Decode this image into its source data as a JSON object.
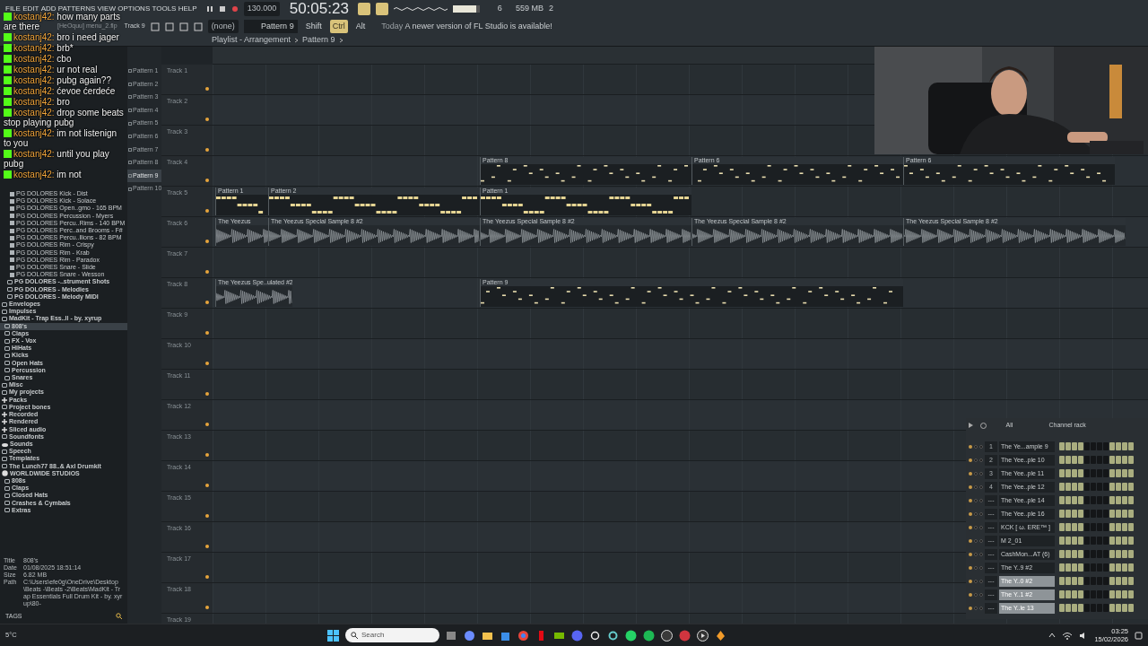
{
  "menu": [
    "FILE",
    "EDIT",
    "ADD",
    "PATTERNS",
    "VIEW",
    "OPTIONS",
    "TOOLS",
    "HELP"
  ],
  "project_file": "[HeOquu] menu_2.flp",
  "transport": {
    "tempo": "130.000",
    "time": "50:05:23"
  },
  "master_volume": {
    "level": 0.85
  },
  "toolbar": {
    "track_hint": "Track 9",
    "snap": "(none)",
    "pattern": "Pattern 9",
    "modifiers": [
      {
        "label": "Shift",
        "on": false
      },
      {
        "label": "Ctrl",
        "on": true
      },
      {
        "label": "Alt",
        "on": false
      }
    ],
    "news_date": "Today",
    "news": "A newer version of FL Studio is available!",
    "cpu": "6",
    "memory": "559 MB",
    "voices": "2"
  },
  "breadcrumb": [
    "Playlist - Arrangement",
    "Pattern 9"
  ],
  "chat": [
    {
      "user": "kostanj42:",
      "text": "how many parts are there"
    },
    {
      "user": "kostanj42:",
      "text": "bro i need jager"
    },
    {
      "user": "kostanj42:",
      "text": "brb*"
    },
    {
      "user": "kostanj42:",
      "text": "cbo"
    },
    {
      "user": "kostanj42:",
      "text": "ur not real"
    },
    {
      "user": "kostanj42:",
      "text": "pubg again??"
    },
    {
      "user": "kostanj42:",
      "text": "ćevoe ćerdeće"
    },
    {
      "user": "kostanj42:",
      "text": "bro"
    },
    {
      "user": "kostanj42:",
      "text": "drop some beats stop playing pubg"
    },
    {
      "user": "kostanj42:",
      "text": "im not listenign to you"
    },
    {
      "user": "kostanj42:",
      "text": "until you play pubg"
    },
    {
      "user": "kostanj42:",
      "text": "im not"
    }
  ],
  "patterns": [
    {
      "label": "Pattern 1",
      "selected": false
    },
    {
      "label": "Pattern 2",
      "selected": false
    },
    {
      "label": "Pattern 3",
      "selected": false
    },
    {
      "label": "Pattern 4",
      "selected": false
    },
    {
      "label": "Pattern 5",
      "selected": false
    },
    {
      "label": "Pattern 6",
      "selected": false
    },
    {
      "label": "Pattern 7",
      "selected": false
    },
    {
      "label": "Pattern 8",
      "selected": false
    },
    {
      "label": "Pattern 9",
      "selected": true
    },
    {
      "label": "Pattern 10",
      "selected": false
    }
  ],
  "browser": {
    "upper_files": [
      "PG DOLORES Kick - Dist",
      "PG DOLORES Kick - Solace",
      "PG DOLORES Open..gmo - 165 BPM",
      "PG DOLORES Percussion - Myers",
      "PG DOLORES Percu..Rims - 140 BPM",
      "PG DOLORES Perc..and Brooms - F#",
      "PG DOLORES Percu..llions - 82 BPM",
      "PG DOLORES Rim - Crispy",
      "PG DOLORES Rim - Krab",
      "PG DOLORES Rim - Paradox",
      "PG DOLORES Snare - Slide",
      "PG DOLORES Snare - Wesson"
    ],
    "upper_folders": [
      "PG DOLORES -..strument Shots",
      "PG DOLORES - Melodies",
      "PG DOLORES - Melody MIDI"
    ],
    "tree": [
      {
        "label": "Envelopes",
        "kind": "folder"
      },
      {
        "label": "Impulses",
        "kind": "folder"
      },
      {
        "label": "MadKit - Trap Ess..ll - by. xyrup",
        "kind": "folder",
        "children": [
          {
            "label": "808's",
            "kind": "folder",
            "selected": true
          },
          {
            "label": "Claps",
            "kind": "folder",
            "selected": false
          },
          {
            "label": "FX - Vox",
            "kind": "folder",
            "selected": false
          },
          {
            "label": "HiHats",
            "kind": "folder",
            "selected": false
          },
          {
            "label": "Kicks",
            "kind": "folder",
            "selected": false
          },
          {
            "label": "Open Hats",
            "kind": "folder",
            "selected": false
          },
          {
            "label": "Percussion",
            "kind": "folder",
            "selected": false
          },
          {
            "label": "Snares",
            "kind": "folder",
            "selected": false
          }
        ]
      },
      {
        "label": "Misc",
        "kind": "folder"
      },
      {
        "label": "My projects",
        "kind": "folder"
      },
      {
        "label": "Packs",
        "kind": "special"
      },
      {
        "label": "Project bones",
        "kind": "folder"
      },
      {
        "label": "Recorded",
        "kind": "special"
      },
      {
        "label": "Rendered",
        "kind": "special"
      },
      {
        "label": "Sliced audio",
        "kind": "special"
      },
      {
        "label": "Soundfonts",
        "kind": "folder"
      },
      {
        "label": "Sounds",
        "kind": "cloud"
      },
      {
        "label": "Speech",
        "kind": "folder"
      },
      {
        "label": "Templates",
        "kind": "folder"
      },
      {
        "label": "The Lunch77 88..& Axl Drumkit",
        "kind": "folder"
      },
      {
        "label": "WORLDWIDE STUDIOS",
        "kind": "globe",
        "children": [
          {
            "label": "808s",
            "kind": "folder"
          },
          {
            "label": "Claps",
            "kind": "folder"
          },
          {
            "label": "Closed Hats",
            "kind": "folder"
          },
          {
            "label": "Crashes & Cymbals",
            "kind": "folder"
          },
          {
            "label": "Extras",
            "kind": "folder"
          }
        ]
      }
    ],
    "info": [
      {
        "key": "Title",
        "value": "808's"
      },
      {
        "key": "Date",
        "value": "01/08/2025 18:51:14"
      },
      {
        "key": "Size",
        "value": "6.82 MB"
      },
      {
        "key": "Path",
        "value": "C:\\Users\\efe0g\\OneDrive\\Desktop\\Beats -\\Beats -2\\Beats\\MadKit - Trap Essentials Full Drum Kit - by. xyrup\\80-"
      }
    ],
    "tags_label": "TAGS"
  },
  "tracks": [
    {
      "label": "Track 1"
    },
    {
      "label": "Track 2"
    },
    {
      "label": "Track 3"
    },
    {
      "label": "Track 4",
      "clips": [
        {
          "kind": "pattern",
          "label": "Pattern 8"
        },
        {
          "kind": "pattern",
          "label": "Pattern 6"
        },
        {
          "kind": "pattern",
          "label": "Pattern 6"
        }
      ]
    },
    {
      "label": "Track 5",
      "clips": [
        {
          "kind": "chords",
          "label": "Pattern 1"
        },
        {
          "kind": "chords",
          "label": "Pattern 2"
        },
        {
          "kind": "chords",
          "label": "Pattern 1"
        }
      ]
    },
    {
      "label": "Track 6",
      "clips": [
        {
          "kind": "audio",
          "label": "The Yeezus"
        },
        {
          "kind": "audio",
          "label": "The Yeezus Special Sample 8 #2"
        },
        {
          "kind": "audio",
          "label": "The Yeezus Special Sample 8 #2"
        },
        {
          "kind": "audio",
          "label": "The Yeezus Special Sample 8 #2"
        },
        {
          "kind": "audio",
          "label": "The Yeezus Special Sample 8 #2"
        }
      ]
    },
    {
      "label": "Track 7"
    },
    {
      "label": "Track 8",
      "clips": [
        {
          "kind": "audio",
          "label": "The Yeezus Spe..ulated #2"
        },
        {
          "kind": "pattern",
          "label": "Pattern 9"
        }
      ]
    },
    {
      "label": "Track 9"
    },
    {
      "label": "Track 10"
    },
    {
      "label": "Track 11"
    },
    {
      "label": "Track 12"
    },
    {
      "label": "Track 13"
    },
    {
      "label": "Track 14"
    },
    {
      "label": "Track 15"
    },
    {
      "label": "Track 16"
    },
    {
      "label": "Track 17"
    },
    {
      "label": "Track 18"
    },
    {
      "label": "Track 19"
    }
  ],
  "channel_rack": {
    "filter": "All",
    "title": "Channel rack",
    "channels": [
      {
        "number": "1",
        "name": "The Ye...ample 9",
        "selected": false,
        "steps": [
          {
            "on": true
          },
          {
            "on": true
          },
          {
            "on": true
          },
          {
            "on": true
          },
          {
            "on": false
          },
          {
            "on": false
          },
          {
            "on": false
          },
          {
            "on": false
          },
          {
            "on": true
          },
          {
            "on": true
          },
          {
            "on": true
          },
          {
            "on": true
          }
        ]
      },
      {
        "number": "2",
        "name": "The Yee..ple 10",
        "selected": false,
        "steps": [
          {
            "on": true
          },
          {
            "on": true
          },
          {
            "on": true
          },
          {
            "on": true
          },
          {
            "on": false
          },
          {
            "on": false
          },
          {
            "on": false
          },
          {
            "on": false
          },
          {
            "on": true
          },
          {
            "on": true
          },
          {
            "on": true
          },
          {
            "on": true
          }
        ]
      },
      {
        "number": "3",
        "name": "The Yee..ple 11",
        "selected": false,
        "steps": [
          {
            "on": true
          },
          {
            "on": true
          },
          {
            "on": true
          },
          {
            "on": true
          },
          {
            "on": false
          },
          {
            "on": false
          },
          {
            "on": false
          },
          {
            "on": false
          },
          {
            "on": true
          },
          {
            "on": true
          },
          {
            "on": true
          },
          {
            "on": true
          }
        ]
      },
      {
        "number": "4",
        "name": "The Yee..ple 12",
        "selected": false,
        "steps": [
          {
            "on": true
          },
          {
            "on": true
          },
          {
            "on": true
          },
          {
            "on": true
          },
          {
            "on": false
          },
          {
            "on": false
          },
          {
            "on": false
          },
          {
            "on": false
          },
          {
            "on": true
          },
          {
            "on": true
          },
          {
            "on": true
          },
          {
            "on": true
          }
        ]
      },
      {
        "number": "---",
        "name": "The Yee..ple 14",
        "selected": false,
        "steps": [
          {
            "on": true
          },
          {
            "on": true
          },
          {
            "on": true
          },
          {
            "on": true
          },
          {
            "on": false
          },
          {
            "on": false
          },
          {
            "on": false
          },
          {
            "on": false
          },
          {
            "on": true
          },
          {
            "on": true
          },
          {
            "on": true
          },
          {
            "on": true
          }
        ]
      },
      {
        "number": "---",
        "name": "The Yee..ple 16",
        "selected": false,
        "steps": [
          {
            "on": true
          },
          {
            "on": true
          },
          {
            "on": true
          },
          {
            "on": true
          },
          {
            "on": false
          },
          {
            "on": false
          },
          {
            "on": false
          },
          {
            "on": false
          },
          {
            "on": true
          },
          {
            "on": true
          },
          {
            "on": true
          },
          {
            "on": true
          }
        ]
      },
      {
        "number": "---",
        "name": "KCK [ ω. ERE™ ]",
        "selected": false,
        "steps": [
          {
            "on": true
          },
          {
            "on": true
          },
          {
            "on": true
          },
          {
            "on": true
          },
          {
            "on": false
          },
          {
            "on": false
          },
          {
            "on": false
          },
          {
            "on": false
          },
          {
            "on": true
          },
          {
            "on": true
          },
          {
            "on": true
          },
          {
            "on": true
          }
        ]
      },
      {
        "number": "---",
        "name": "M 2_01",
        "selected": false,
        "steps": [
          {
            "on": true
          },
          {
            "on": true
          },
          {
            "on": true
          },
          {
            "on": true
          },
          {
            "on": false
          },
          {
            "on": false
          },
          {
            "on": false
          },
          {
            "on": false
          },
          {
            "on": true
          },
          {
            "on": true
          },
          {
            "on": true
          },
          {
            "on": true
          }
        ]
      },
      {
        "number": "---",
        "name": "CashMon...AT (6)",
        "selected": false,
        "steps": [
          {
            "on": true
          },
          {
            "on": true
          },
          {
            "on": true
          },
          {
            "on": true
          },
          {
            "on": false
          },
          {
            "on": false
          },
          {
            "on": false
          },
          {
            "on": false
          },
          {
            "on": true
          },
          {
            "on": true
          },
          {
            "on": true
          },
          {
            "on": true
          }
        ]
      },
      {
        "number": "---",
        "name": "The Y..9 #2",
        "selected": false,
        "steps": [
          {
            "on": true
          },
          {
            "on": true
          },
          {
            "on": true
          },
          {
            "on": true
          },
          {
            "on": false
          },
          {
            "on": false
          },
          {
            "on": false
          },
          {
            "on": false
          },
          {
            "on": true
          },
          {
            "on": true
          },
          {
            "on": true
          },
          {
            "on": true
          }
        ]
      },
      {
        "number": "---",
        "name": "The Y..0 #2",
        "selected": true,
        "steps": [
          {
            "on": true
          },
          {
            "on": true
          },
          {
            "on": true
          },
          {
            "on": true
          },
          {
            "on": false
          },
          {
            "on": false
          },
          {
            "on": false
          },
          {
            "on": false
          },
          {
            "on": true
          },
          {
            "on": true
          },
          {
            "on": true
          },
          {
            "on": true
          }
        ]
      },
      {
        "number": "---",
        "name": "The Y..1 #2",
        "selected": true,
        "steps": [
          {
            "on": true
          },
          {
            "on": true
          },
          {
            "on": true
          },
          {
            "on": true
          },
          {
            "on": false
          },
          {
            "on": false
          },
          {
            "on": false
          },
          {
            "on": false
          },
          {
            "on": true
          },
          {
            "on": true
          },
          {
            "on": true
          },
          {
            "on": true
          }
        ]
      },
      {
        "number": "---",
        "name": "The Y..le 13",
        "selected": true,
        "steps": [
          {
            "on": true
          },
          {
            "on": true
          },
          {
            "on": true
          },
          {
            "on": true
          },
          {
            "on": false
          },
          {
            "on": false
          },
          {
            "on": false
          },
          {
            "on": false
          },
          {
            "on": true
          },
          {
            "on": true
          },
          {
            "on": true
          },
          {
            "on": true
          }
        ]
      }
    ]
  },
  "taskbar": {
    "weather": "5°C",
    "search_placeholder": "Search",
    "time": "03:25",
    "date": "15/02/2026"
  }
}
